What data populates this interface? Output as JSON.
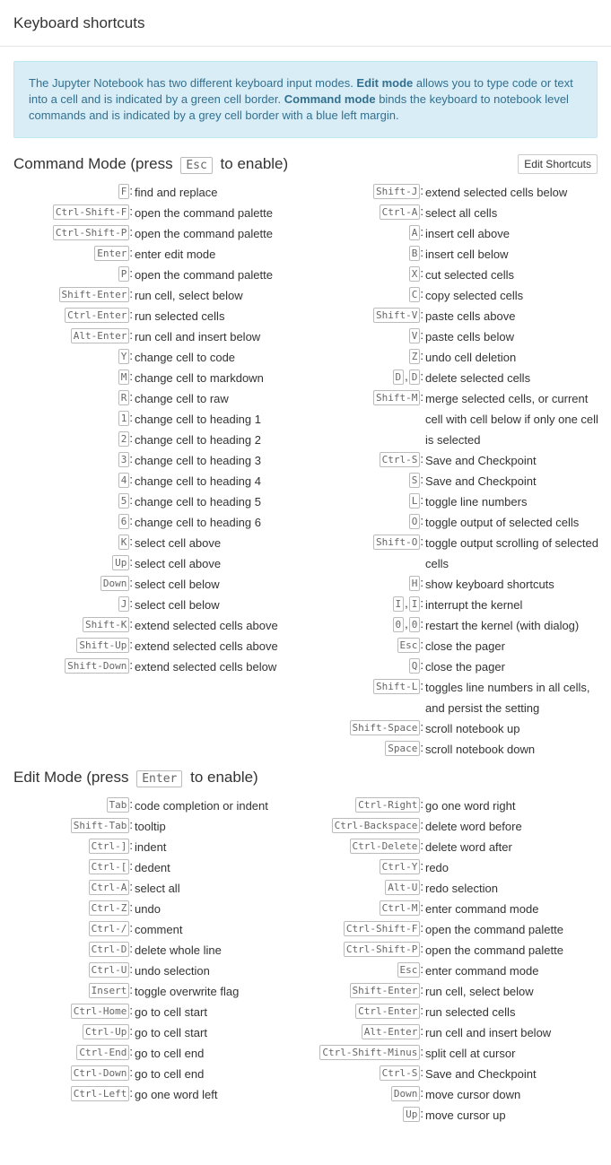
{
  "title": "Keyboard shortcuts",
  "info": {
    "p1": "The Jupyter Notebook has two different keyboard input modes. ",
    "b1": "Edit mode",
    "p2": " allows you to type code or text into a cell and is indicated by a green cell border. ",
    "b2": "Command mode",
    "p3": " binds the keyboard to notebook level commands and is indicated by a grey cell border with a blue left margin."
  },
  "command_mode": {
    "title_pre": "Command Mode (press ",
    "title_key": "Esc",
    "title_post": " to enable)",
    "edit_button": "Edit Shortcuts",
    "left": [
      {
        "keys": [
          "F"
        ],
        "desc": "find and replace"
      },
      {
        "keys": [
          "Ctrl-Shift-F"
        ],
        "desc": "open the command palette"
      },
      {
        "keys": [
          "Ctrl-Shift-P"
        ],
        "desc": "open the command palette"
      },
      {
        "keys": [
          "Enter"
        ],
        "desc": "enter edit mode"
      },
      {
        "keys": [
          "P"
        ],
        "desc": "open the command palette"
      },
      {
        "keys": [
          "Shift-Enter"
        ],
        "desc": "run cell, select below"
      },
      {
        "keys": [
          "Ctrl-Enter"
        ],
        "desc": "run selected cells"
      },
      {
        "keys": [
          "Alt-Enter"
        ],
        "desc": "run cell and insert below"
      },
      {
        "keys": [
          "Y"
        ],
        "desc": "change cell to code"
      },
      {
        "keys": [
          "M"
        ],
        "desc": "change cell to markdown"
      },
      {
        "keys": [
          "R"
        ],
        "desc": "change cell to raw"
      },
      {
        "keys": [
          "1"
        ],
        "desc": "change cell to heading 1"
      },
      {
        "keys": [
          "2"
        ],
        "desc": "change cell to heading 2"
      },
      {
        "keys": [
          "3"
        ],
        "desc": "change cell to heading 3"
      },
      {
        "keys": [
          "4"
        ],
        "desc": "change cell to heading 4"
      },
      {
        "keys": [
          "5"
        ],
        "desc": "change cell to heading 5"
      },
      {
        "keys": [
          "6"
        ],
        "desc": "change cell to heading 6"
      },
      {
        "keys": [
          "K"
        ],
        "desc": "select cell above"
      },
      {
        "keys": [
          "Up"
        ],
        "desc": "select cell above"
      },
      {
        "keys": [
          "Down"
        ],
        "desc": "select cell below"
      },
      {
        "keys": [
          "J"
        ],
        "desc": "select cell below"
      },
      {
        "keys": [
          "Shift-K"
        ],
        "desc": "extend selected cells above"
      },
      {
        "keys": [
          "Shift-Up"
        ],
        "desc": "extend selected cells above"
      },
      {
        "keys": [
          "Shift-Down"
        ],
        "desc": "extend selected cells below"
      }
    ],
    "right": [
      {
        "keys": [
          "Shift-J"
        ],
        "desc": "extend selected cells below"
      },
      {
        "keys": [
          "Ctrl-A"
        ],
        "desc": "select all cells"
      },
      {
        "keys": [
          "A"
        ],
        "desc": "insert cell above"
      },
      {
        "keys": [
          "B"
        ],
        "desc": "insert cell below"
      },
      {
        "keys": [
          "X"
        ],
        "desc": "cut selected cells"
      },
      {
        "keys": [
          "C"
        ],
        "desc": "copy selected cells"
      },
      {
        "keys": [
          "Shift-V"
        ],
        "desc": "paste cells above"
      },
      {
        "keys": [
          "V"
        ],
        "desc": "paste cells below"
      },
      {
        "keys": [
          "Z"
        ],
        "desc": "undo cell deletion"
      },
      {
        "keys": [
          "D",
          "D"
        ],
        "desc": "delete selected cells"
      },
      {
        "keys": [
          "Shift-M"
        ],
        "desc": "merge selected cells, or current cell with cell below if only one cell is selected"
      },
      {
        "keys": [
          "Ctrl-S"
        ],
        "desc": "Save and Checkpoint"
      },
      {
        "keys": [
          "S"
        ],
        "desc": "Save and Checkpoint"
      },
      {
        "keys": [
          "L"
        ],
        "desc": "toggle line numbers"
      },
      {
        "keys": [
          "O"
        ],
        "desc": "toggle output of selected cells"
      },
      {
        "keys": [
          "Shift-O"
        ],
        "desc": "toggle output scrolling of selected cells"
      },
      {
        "keys": [
          "H"
        ],
        "desc": "show keyboard shortcuts"
      },
      {
        "keys": [
          "I",
          "I"
        ],
        "desc": "interrupt the kernel"
      },
      {
        "keys": [
          "0",
          "0"
        ],
        "desc": "restart the kernel (with dialog)"
      },
      {
        "keys": [
          "Esc"
        ],
        "desc": "close the pager"
      },
      {
        "keys": [
          "Q"
        ],
        "desc": "close the pager"
      },
      {
        "keys": [
          "Shift-L"
        ],
        "desc": "toggles line numbers in all cells, and persist the setting"
      },
      {
        "keys": [
          "Shift-Space"
        ],
        "desc": "scroll notebook up"
      },
      {
        "keys": [
          "Space"
        ],
        "desc": "scroll notebook down"
      }
    ]
  },
  "edit_mode": {
    "title_pre": "Edit Mode (press ",
    "title_key": "Enter",
    "title_post": " to enable)",
    "left": [
      {
        "keys": [
          "Tab"
        ],
        "desc": "code completion or indent"
      },
      {
        "keys": [
          "Shift-Tab"
        ],
        "desc": "tooltip"
      },
      {
        "keys": [
          "Ctrl-]"
        ],
        "desc": "indent"
      },
      {
        "keys": [
          "Ctrl-["
        ],
        "desc": "dedent"
      },
      {
        "keys": [
          "Ctrl-A"
        ],
        "desc": "select all"
      },
      {
        "keys": [
          "Ctrl-Z"
        ],
        "desc": "undo"
      },
      {
        "keys": [
          "Ctrl-/"
        ],
        "desc": "comment"
      },
      {
        "keys": [
          "Ctrl-D"
        ],
        "desc": "delete whole line"
      },
      {
        "keys": [
          "Ctrl-U"
        ],
        "desc": "undo selection"
      },
      {
        "keys": [
          "Insert"
        ],
        "desc": "toggle overwrite flag"
      },
      {
        "keys": [
          "Ctrl-Home"
        ],
        "desc": "go to cell start"
      },
      {
        "keys": [
          "Ctrl-Up"
        ],
        "desc": "go to cell start"
      },
      {
        "keys": [
          "Ctrl-End"
        ],
        "desc": "go to cell end"
      },
      {
        "keys": [
          "Ctrl-Down"
        ],
        "desc": "go to cell end"
      },
      {
        "keys": [
          "Ctrl-Left"
        ],
        "desc": "go one word left"
      }
    ],
    "right": [
      {
        "keys": [
          "Ctrl-Right"
        ],
        "desc": "go one word right"
      },
      {
        "keys": [
          "Ctrl-Backspace"
        ],
        "desc": "delete word before"
      },
      {
        "keys": [
          "Ctrl-Delete"
        ],
        "desc": "delete word after"
      },
      {
        "keys": [
          "Ctrl-Y"
        ],
        "desc": "redo"
      },
      {
        "keys": [
          "Alt-U"
        ],
        "desc": "redo selection"
      },
      {
        "keys": [
          "Ctrl-M"
        ],
        "desc": "enter command mode"
      },
      {
        "keys": [
          "Ctrl-Shift-F"
        ],
        "desc": "open the command palette"
      },
      {
        "keys": [
          "Ctrl-Shift-P"
        ],
        "desc": "open the command palette"
      },
      {
        "keys": [
          "Esc"
        ],
        "desc": "enter command mode"
      },
      {
        "keys": [
          "Shift-Enter"
        ],
        "desc": "run cell, select below"
      },
      {
        "keys": [
          "Ctrl-Enter"
        ],
        "desc": "run selected cells"
      },
      {
        "keys": [
          "Alt-Enter"
        ],
        "desc": "run cell and insert below"
      },
      {
        "keys": [
          "Ctrl-Shift-Minus"
        ],
        "desc": "split cell at cursor"
      },
      {
        "keys": [
          "Ctrl-S"
        ],
        "desc": "Save and Checkpoint"
      },
      {
        "keys": [
          "Down"
        ],
        "desc": "move cursor down"
      },
      {
        "keys": [
          "Up"
        ],
        "desc": "move cursor up"
      }
    ]
  }
}
